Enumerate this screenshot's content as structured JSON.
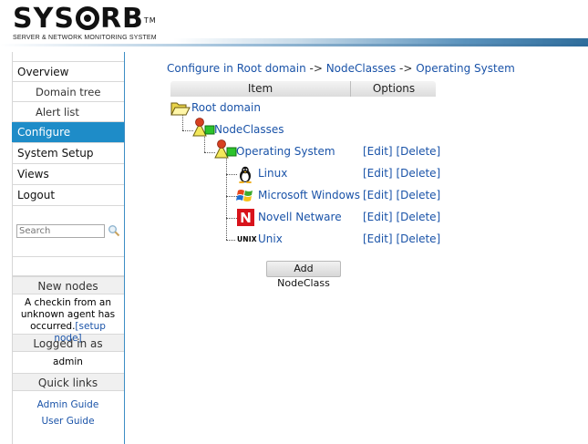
{
  "header": {
    "logo_text_left": "SYS",
    "logo_text_right": "RB",
    "trademark": "TM",
    "subtitle": "SERVER & NETWORK MONITORING SYSTEM"
  },
  "sidebar": {
    "nav": [
      {
        "label": "Overview"
      },
      {
        "label": "Domain tree"
      },
      {
        "label": "Alert list"
      },
      {
        "label": "Configure"
      },
      {
        "label": "System Setup"
      },
      {
        "label": "Views"
      },
      {
        "label": "Logout"
      }
    ],
    "search_placeholder": "Search",
    "new_nodes": {
      "heading": "New nodes",
      "message": "A checkin from an unknown agent has occurred.",
      "link": "[setup node]"
    },
    "logged_in": {
      "heading": "Logged in as",
      "user": "admin"
    },
    "quick_links": {
      "heading": "Quick links",
      "links": [
        {
          "label": "Admin Guide"
        },
        {
          "label": "User Guide"
        }
      ]
    }
  },
  "main": {
    "breadcrumb": {
      "part1": "Configure in Root domain",
      "sep1": " -> ",
      "part2": "NodeClasses",
      "sep2": " -> ",
      "part3": "Operating System"
    },
    "table": {
      "col_item": "Item",
      "col_options": "Options"
    },
    "tree": {
      "root": "Root domain",
      "nodeclasses": "NodeClasses",
      "os": "Operating System",
      "children": [
        {
          "label": "Linux",
          "icon": "linux-icon"
        },
        {
          "label": "Microsoft Windows",
          "icon": "windows-icon"
        },
        {
          "label": "Novell Netware",
          "icon": "novell-icon"
        },
        {
          "label": "Unix",
          "icon": "unix-icon"
        }
      ]
    },
    "options": {
      "edit": "[Edit]",
      "delete": "[Delete]"
    },
    "add_button": "Add NodeClass",
    "unix_icon_text": "UNIX"
  }
}
